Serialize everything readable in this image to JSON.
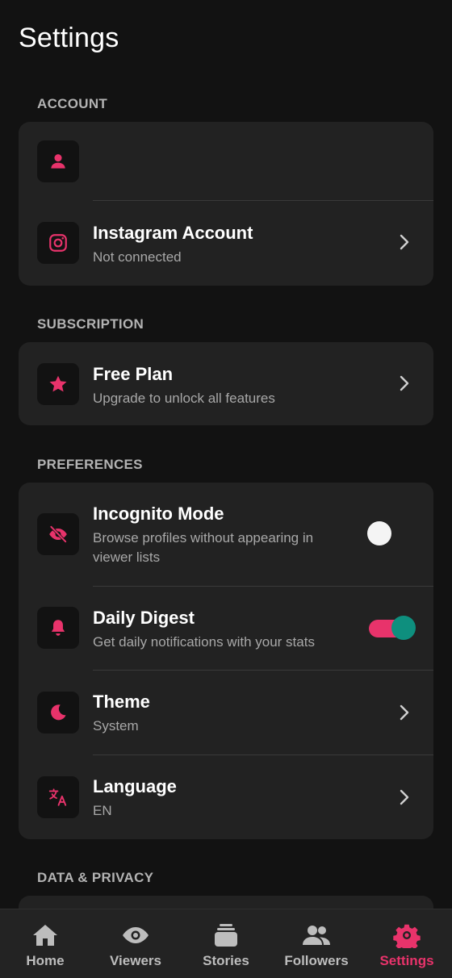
{
  "page": {
    "title": "Settings"
  },
  "colors": {
    "accent": "#e8336b",
    "toggle_on_knob": "#0e8f7e",
    "background": "#121212",
    "card": "#222222"
  },
  "sections": {
    "account": {
      "header": "ACCOUNT",
      "profile": {
        "icon": "person-icon",
        "title": "",
        "subtitle": ""
      },
      "instagram": {
        "icon": "instagram-icon",
        "title": "Instagram Account",
        "subtitle": "Not connected"
      }
    },
    "subscription": {
      "header": "SUBSCRIPTION",
      "plan": {
        "icon": "star-icon",
        "title": "Free Plan",
        "subtitle": "Upgrade to unlock all features"
      }
    },
    "preferences": {
      "header": "PREFERENCES",
      "incognito": {
        "icon": "eye-off-icon",
        "title": "Incognito Mode",
        "subtitle": "Browse profiles without appearing in viewer lists",
        "enabled": false
      },
      "digest": {
        "icon": "bell-icon",
        "title": "Daily Digest",
        "subtitle": "Get daily notifications with your stats",
        "enabled": true
      },
      "theme": {
        "icon": "moon-icon",
        "title": "Theme",
        "subtitle": "System"
      },
      "language": {
        "icon": "translate-icon",
        "title": "Language",
        "subtitle": "EN"
      }
    },
    "data_privacy": {
      "header": "DATA & PRIVACY"
    }
  },
  "nav": {
    "items": [
      {
        "label": "Home",
        "icon": "home-icon",
        "active": false
      },
      {
        "label": "Viewers",
        "icon": "eye-icon",
        "active": false
      },
      {
        "label": "Stories",
        "icon": "stories-icon",
        "active": false
      },
      {
        "label": "Followers",
        "icon": "followers-icon",
        "active": false
      },
      {
        "label": "Settings",
        "icon": "gear-icon",
        "active": true
      }
    ]
  }
}
